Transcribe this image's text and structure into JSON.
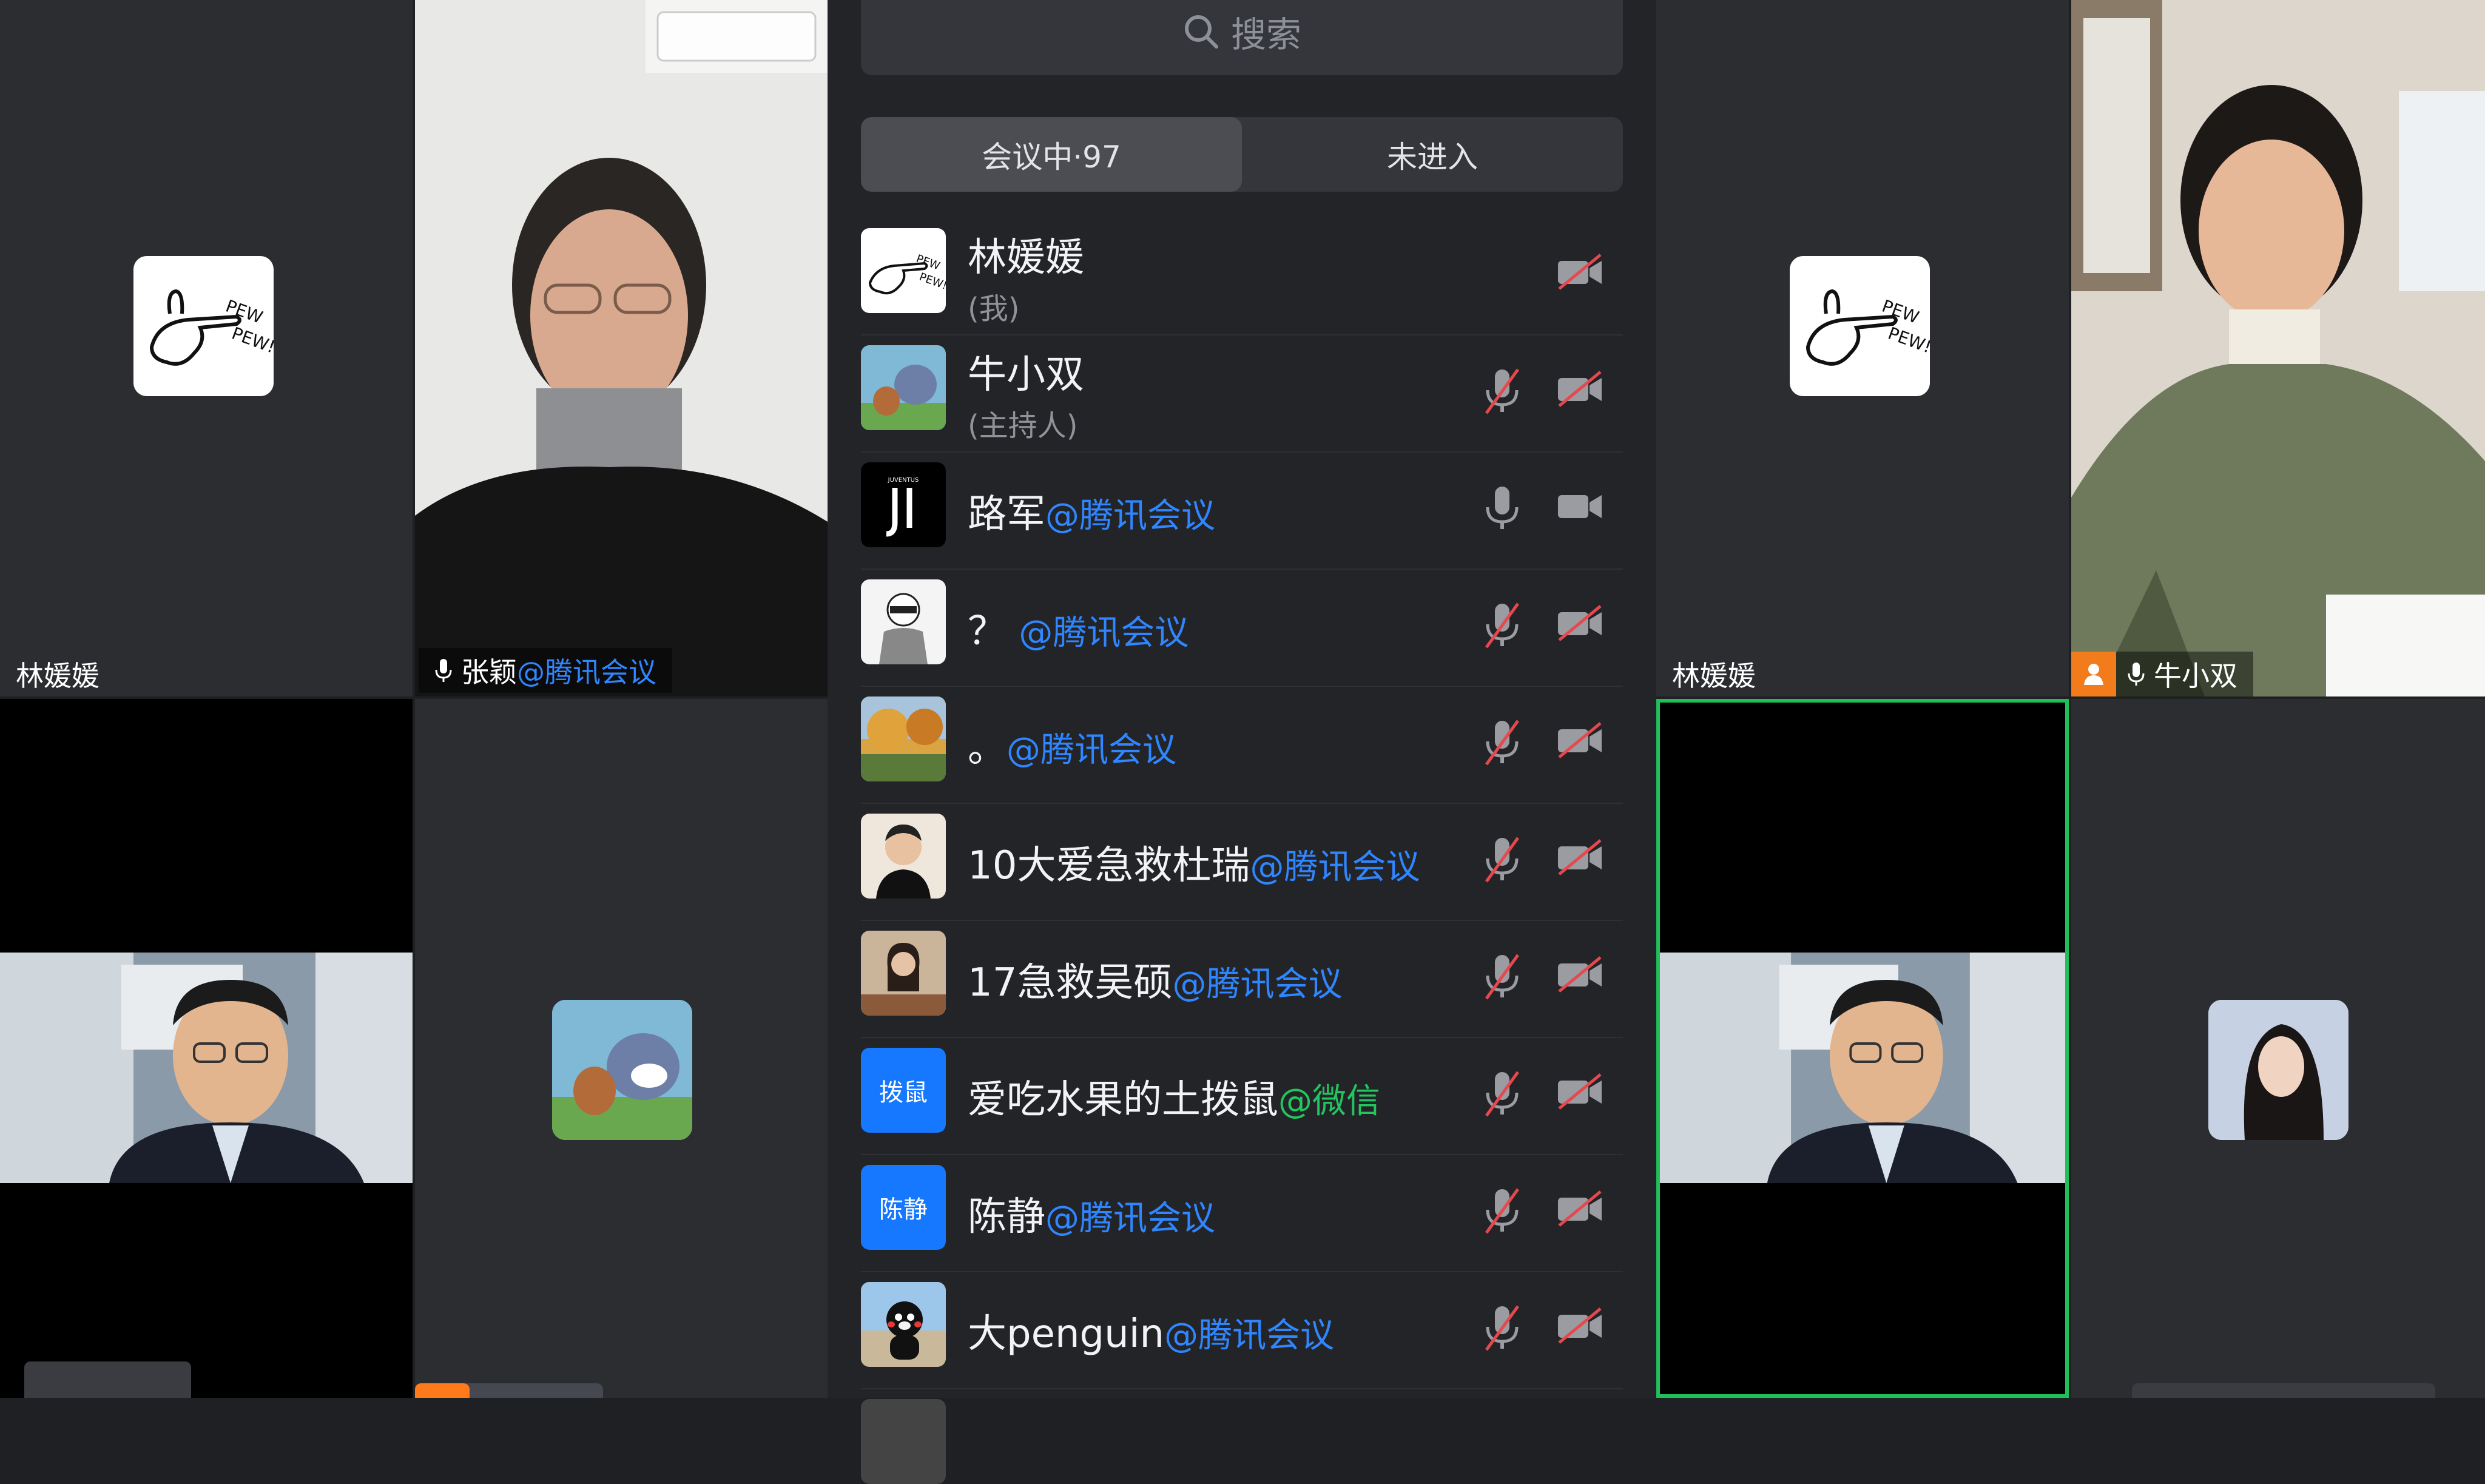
{
  "search": {
    "placeholder": "搜索"
  },
  "tabs": [
    {
      "label": "会议中·97",
      "active": true
    },
    {
      "label": "未进入",
      "active": false
    }
  ],
  "participants": [
    {
      "name": "林媛媛",
      "sub": "(我)",
      "tag": "",
      "mic": "none",
      "cam": "off",
      "avatar": "pewpew"
    },
    {
      "name": "牛小双",
      "sub": "(主持人)",
      "tag": "",
      "mic": "off",
      "cam": "off",
      "avatar": "tomjerry"
    },
    {
      "name": "路军",
      "sub": "",
      "tag": "@腾讯会议",
      "mic": "on",
      "cam": "on",
      "avatar": "juventus"
    },
    {
      "name": "？",
      "sub": "",
      "tag": "@腾讯会议",
      "mic": "off",
      "cam": "off",
      "avatar": "cartoon"
    },
    {
      "name": "。",
      "sub": "",
      "tag": "@腾讯会议",
      "mic": "off",
      "cam": "off",
      "avatar": "autumn"
    },
    {
      "name": "10大爱急救杜瑞",
      "sub": "",
      "tag": "@腾讯会议",
      "mic": "off",
      "cam": "off",
      "avatar": "man"
    },
    {
      "name": "17急救吴硕",
      "sub": "",
      "tag": "@腾讯会议",
      "mic": "off",
      "cam": "off",
      "avatar": "girl"
    },
    {
      "name": "爱吃水果的土拨鼠",
      "sub": "",
      "tag": "@微信",
      "mic": "off",
      "cam": "off",
      "avatar": "text",
      "avatar_text": "拨鼠"
    },
    {
      "name": "陈静",
      "sub": "",
      "tag": "@腾讯会议",
      "mic": "off",
      "cam": "off",
      "avatar": "text",
      "avatar_text": "陈静"
    },
    {
      "name": "大penguin",
      "sub": "",
      "tag": "@腾讯会议",
      "mic": "off",
      "cam": "off",
      "avatar": "kumamon"
    }
  ],
  "tiles": {
    "left_top_left": {
      "name": "林媛媛"
    },
    "left_top_right": {
      "name": "张颖",
      "tag": "@腾讯会议"
    },
    "right_top_left": {
      "name": "林媛媛"
    },
    "right_top_right": {
      "name": "牛小双"
    }
  },
  "colors": {
    "accent_blue": "#2f86ff",
    "wechat_green": "#22c55e",
    "active_border": "#1fbf5a",
    "muted_red": "#e5484d"
  }
}
